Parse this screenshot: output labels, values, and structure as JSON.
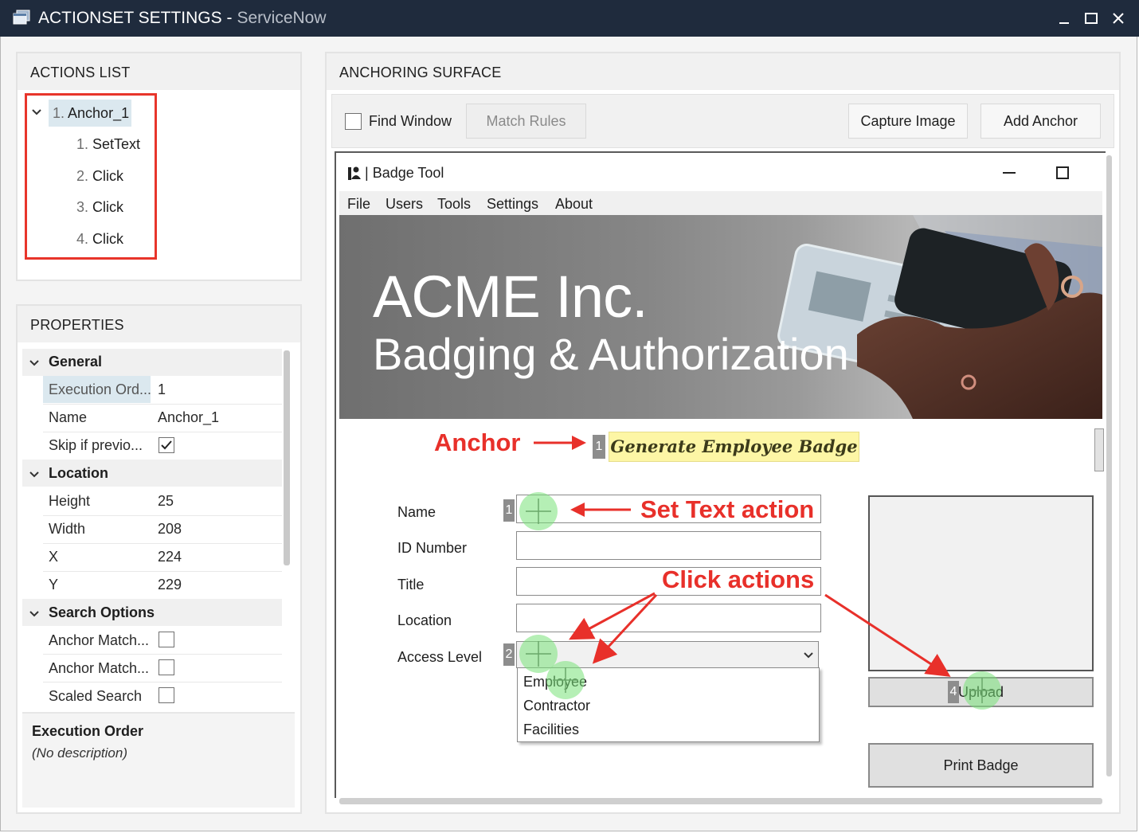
{
  "window": {
    "title": "ACTIONSET SETTINGS  -",
    "subtitle": "ServiceNow",
    "controls": [
      "minimize",
      "maximize",
      "close"
    ]
  },
  "actions_list": {
    "header": "ACTIONS LIST",
    "root": {
      "num": "1.",
      "label": "Anchor_1",
      "expanded": true,
      "selected": true
    },
    "children": [
      {
        "num": "1.",
        "label": "SetText"
      },
      {
        "num": "2.",
        "label": "Click"
      },
      {
        "num": "3.",
        "label": "Click"
      },
      {
        "num": "4.",
        "label": "Click"
      }
    ]
  },
  "properties": {
    "header": "PROPERTIES",
    "categories": [
      {
        "name": "General",
        "rows": [
          {
            "key": "Execution Ord...",
            "value": "1",
            "selected": true
          },
          {
            "key": "Name",
            "value": "Anchor_1"
          },
          {
            "key": "Skip if previo...",
            "checkbox": true,
            "checked": true
          }
        ]
      },
      {
        "name": "Location",
        "rows": [
          {
            "key": "Height",
            "value": "25"
          },
          {
            "key": "Width",
            "value": "208"
          },
          {
            "key": "X",
            "value": "224"
          },
          {
            "key": "Y",
            "value": "229"
          }
        ]
      },
      {
        "name": "Search Options",
        "rows": [
          {
            "key": "Anchor Match...",
            "checkbox": true,
            "checked": false
          },
          {
            "key": "Anchor Match...",
            "checkbox": true,
            "checked": false
          },
          {
            "key": "Scaled Search",
            "checkbox": true,
            "checked": false
          }
        ]
      }
    ],
    "description_title": "Execution Order",
    "description_text": "(No description)"
  },
  "anchoring": {
    "header": "ANCHORING SURFACE",
    "find_window_label": "Find Window",
    "find_window_checked": false,
    "match_rules_label": "Match Rules",
    "capture_image_label": "Capture Image",
    "add_anchor_label": "Add Anchor"
  },
  "badge_tool": {
    "title": "Badge Tool",
    "menu": [
      "File",
      "Users",
      "Tools",
      "Settings",
      "About"
    ],
    "banner_title": "ACME Inc.",
    "banner_subtitle": "Badging & Authorization",
    "anchor_index": "1",
    "anchor_text": "Generate Employee Badge",
    "form_labels": [
      "Name",
      "ID Number",
      "Title",
      "Location",
      "Access Level"
    ],
    "tag_name_index": "1",
    "tag_access_index": "2",
    "tag_upload_index": "4",
    "dropdown_options": [
      "Employee",
      "Contractor",
      "Facilities"
    ],
    "upload_label": "Upload",
    "print_label": "Print Badge"
  },
  "annotations": {
    "anchor": "Anchor",
    "set_text": "Set Text action",
    "click": "Click actions",
    "color": "#e8302a"
  },
  "colors": {
    "titlebar": "#1f2b3d",
    "selection": "#dbe8ef",
    "highlight_box": "#e8352b",
    "anchor_bg": "#fdf6a5",
    "marker": "#78e178"
  }
}
